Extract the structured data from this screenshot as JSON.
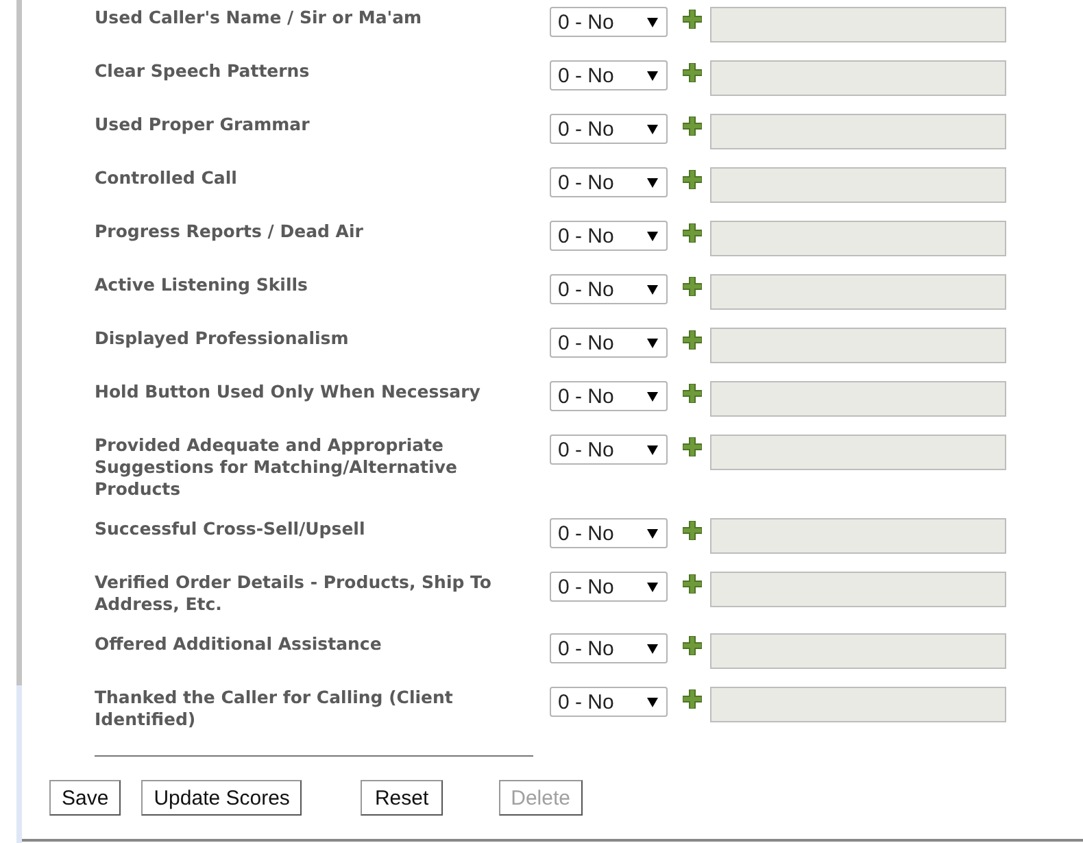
{
  "rows": [
    {
      "label": "Used Caller's Name / Sir or Ma'am",
      "score": "0 - No"
    },
    {
      "label": "Clear Speech Patterns",
      "score": "0 - No"
    },
    {
      "label": "Used Proper Grammar",
      "score": "0 - No"
    },
    {
      "label": "Controlled Call",
      "score": "0 - No"
    },
    {
      "label": "Progress Reports / Dead Air",
      "score": "0 - No"
    },
    {
      "label": "Active Listening Skills",
      "score": "0 - No"
    },
    {
      "label": "Displayed Professionalism",
      "score": "0 - No"
    },
    {
      "label": "Hold Button Used Only When Necessary",
      "score": "0 - No"
    },
    {
      "label": "Provided Adequate and Appropriate Suggestions for Matching/Alternative Products",
      "score": "0 - No"
    },
    {
      "label": "Successful Cross-Sell/Upsell",
      "score": "0 - No"
    },
    {
      "label": "Verified Order Details - Products, Ship To Address, Etc.",
      "score": "0 - No"
    },
    {
      "label": "Offered Additional Assistance",
      "score": "0 - No"
    },
    {
      "label": "Thanked the Caller for Calling (Client Identified)",
      "score": "0 - No"
    }
  ],
  "buttons": [
    {
      "label": "Save",
      "disabled": false
    },
    {
      "label": "Update Scores",
      "disabled": false
    },
    {
      "label": "Reset",
      "disabled": false
    },
    {
      "label": "Delete",
      "disabled": true
    }
  ]
}
